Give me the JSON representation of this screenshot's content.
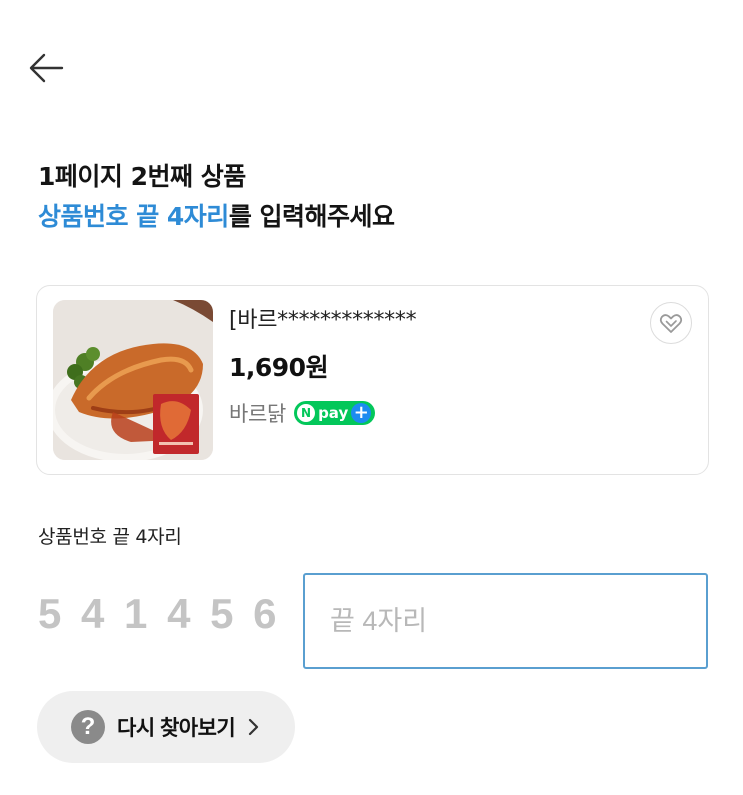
{
  "header": {
    "back_icon": "arrow-left-icon"
  },
  "heading": {
    "line1": "1페이지 2번째 상품",
    "line2_accent": "상품번호 끝 4자리",
    "line2_rest": "를 입력해주세요"
  },
  "product": {
    "name": "[바르*************",
    "price": "1,690원",
    "store": "바르닭",
    "npay_label": "pay",
    "npay_n": "N",
    "npay_plus": "+",
    "wish_icon": "heart-icon"
  },
  "code_entry": {
    "label": "상품번호 끝 4자리",
    "prefix_digits": "5 4 1 4 5 6",
    "input_value": "",
    "input_placeholder": "끝 4자리"
  },
  "retry": {
    "icon": "question-icon",
    "icon_glyph": "?",
    "label": "다시 찾아보기"
  },
  "colors": {
    "accent": "#2e8bd6",
    "npay_green": "#03c75a",
    "input_border": "#5a9fd0"
  }
}
